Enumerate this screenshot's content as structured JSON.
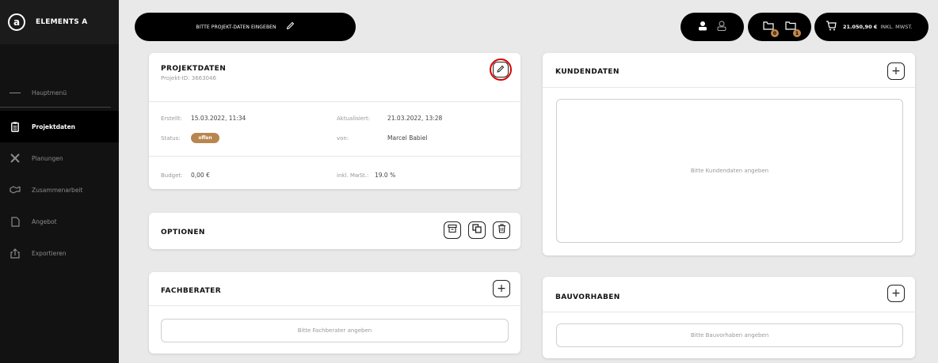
{
  "sidebar": {
    "brand": {
      "logo": "a",
      "name": "ELEMENTS A"
    },
    "items": [
      {
        "label": "Hauptmenü",
        "icon": "menu-icon"
      },
      {
        "label": "Projektdaten",
        "icon": "clipboard-icon"
      },
      {
        "label": "Planungen",
        "icon": "tools-icon"
      },
      {
        "label": "Zusammenarbeit",
        "icon": "handshake-icon"
      },
      {
        "label": "Angebot",
        "icon": "document-icon"
      },
      {
        "label": "Exportieren",
        "icon": "export-icon"
      }
    ]
  },
  "topbar": {
    "project_name_placeholder": "BITTE PROJEKT-DATEN EINGEBEN",
    "files_badge_1": "0",
    "files_badge_2": "1",
    "cart_amount": "21.050,90 €",
    "cart_tax_note": "INKL. MWST."
  },
  "projektdaten": {
    "title": "PROJEKTDATEN",
    "project_id_label": "Projekt-ID:",
    "project_id": "3663046",
    "created_label": "Erstellt:",
    "created_value": "15.03.2022, 11:34",
    "updated_label": "Aktualisiert:",
    "updated_value": "21.03.2022, 13:28",
    "status_label": "Status:",
    "status_value": "offen",
    "by_label": "von:",
    "by_value": "Marcel Babiel",
    "budget_label": "Budget:",
    "budget_value": "0,00 €",
    "tax_label": "inkl. MwSt.:",
    "tax_value": "19.0 %"
  },
  "optionen": {
    "title": "OPTIONEN"
  },
  "fachberater": {
    "title": "FACHBERATER",
    "placeholder": "Bitte Fachberater angeben"
  },
  "kundendaten": {
    "title": "KUNDENDATEN",
    "placeholder": "Bitte Kundendaten angeben"
  },
  "bauvorhaben": {
    "title": "BAUVORHABEN",
    "placeholder": "Bitte Bauvorhaben angeben"
  },
  "colors": {
    "accent": "#b8864e",
    "highlight_ring": "#d90000",
    "sidebar_bg": "#121212"
  }
}
